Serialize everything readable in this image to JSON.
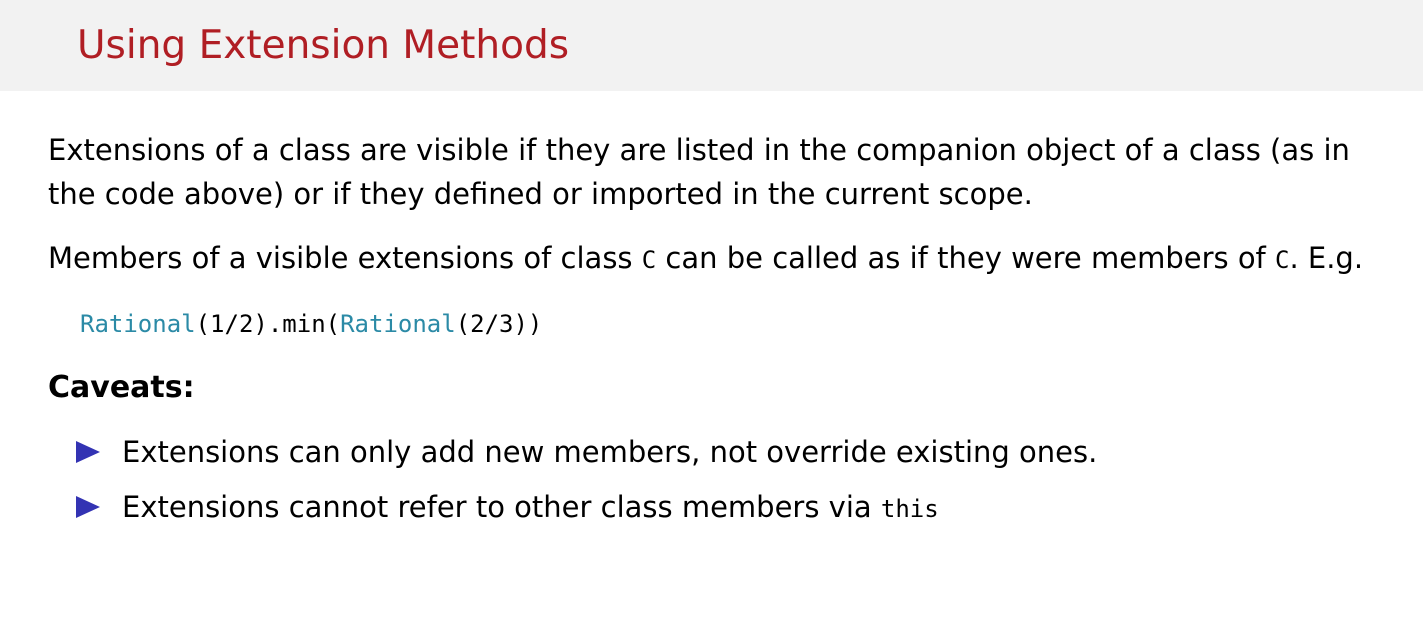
{
  "slide": {
    "title": "Using Extension Methods"
  },
  "para1": {
    "text": "Extensions of a class are visible if they are listed in the companion object of a class (as in the code above) or if they defined or imported in the current scope."
  },
  "para2": {
    "text1": "Members of a visible extensions of class ",
    "code1": "C",
    "text2": " can be called as if they were members of ",
    "code2": "C",
    "text3": ". E.g."
  },
  "code": {
    "tok1": "Rational",
    "tok2": "(1/2).min(",
    "tok3": "Rational",
    "tok4": "(2/3))",
    "type_color": "#2b8aa6"
  },
  "caveats": {
    "title": "Caveats:",
    "items": [
      {
        "text": "Extensions can only add new members, not override existing ones."
      },
      {
        "text": "Extensions cannot refer to other class members via ",
        "code": "this"
      }
    ]
  },
  "colors": {
    "title": "#b01e24",
    "header_bg": "#f2f2f2",
    "bullet": "#3333b3"
  }
}
